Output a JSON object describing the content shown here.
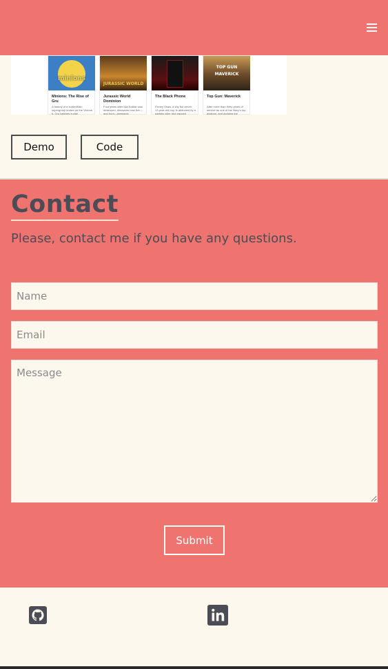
{
  "header": {
    "menu_icon": "hamburger-menu-icon"
  },
  "project": {
    "cards": [
      {
        "poster_text": "minions",
        "title": "Minions: The Rise of Gru",
        "desc": "A fanboy of a supervillain supergroup known as the Vicious 6, Gru hatches a plan"
      },
      {
        "poster_text": "JURASSIC WORLD",
        "title": "Jurassic World Dominion",
        "desc": "Four years after Isla Nublar was destroyed, dinosaurs now live—and hunt—alongside"
      },
      {
        "poster_text": "",
        "title": "The Black Phone",
        "desc": "Finney Shaw, a shy but clever 13-year-old boy, is abducted by a sadistic killer and trapped"
      },
      {
        "poster_text": "TOP GUN MAVERICK",
        "title": "Top Gun: Maverick",
        "desc": "After more than thirty years of service as one of the Navy's top aviators, and dodging the"
      }
    ],
    "demo_label": "Demo",
    "code_label": "Code"
  },
  "contact": {
    "title": "Contact",
    "subtitle": "Please, contact me if you have any questions.",
    "name_placeholder": "Name",
    "email_placeholder": "Email",
    "message_placeholder": "Message",
    "submit_label": "Submit"
  },
  "footer": {
    "icons": [
      "github-icon",
      "linkedin-icon"
    ]
  },
  "colors": {
    "accent": "#ef7470",
    "background": "#fdf8ee",
    "heading": "#4b4c56"
  }
}
